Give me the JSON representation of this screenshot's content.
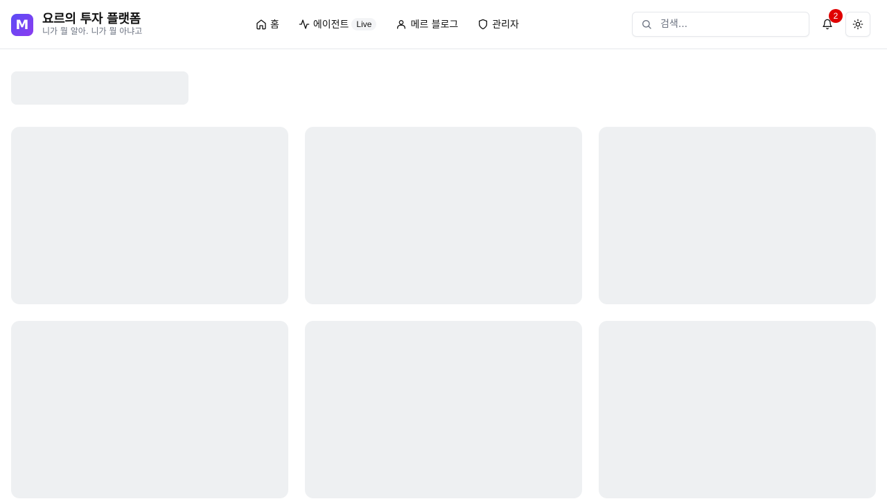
{
  "brand": {
    "logo_letter": "M",
    "title": "요르의 투자 플랫폼",
    "subtitle": "니가 뭘 알아. 니가 뭘 아냐고"
  },
  "nav": {
    "items": [
      {
        "label": "홈",
        "icon": "home-icon"
      },
      {
        "label": "에이전트",
        "icon": "activity-icon",
        "badge": "Live"
      },
      {
        "label": "메르 블로그",
        "icon": "user-icon"
      },
      {
        "label": "관리자",
        "icon": "shield-icon"
      }
    ]
  },
  "search": {
    "placeholder": "검색..."
  },
  "notifications": {
    "count": "2"
  },
  "colors": {
    "accent_start": "#5b4cf5",
    "accent_end": "#8b3cf0",
    "badge": "#e00000",
    "skeleton": "#eef0f2"
  }
}
